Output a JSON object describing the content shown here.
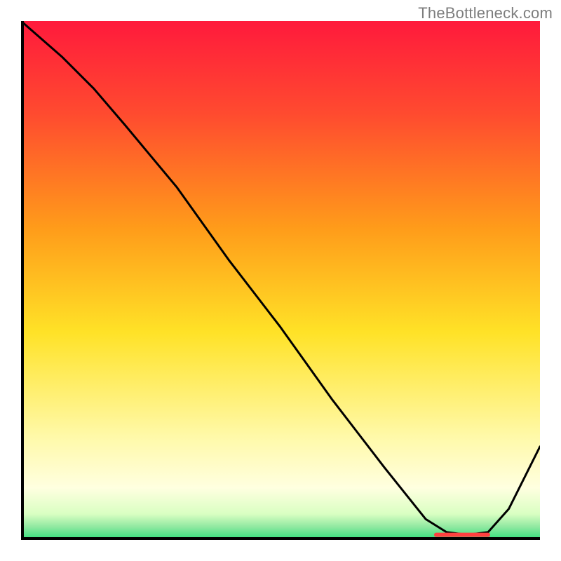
{
  "watermark": "TheBottleneck.com",
  "marker": {
    "label": ""
  },
  "colors": {
    "top": "#ff1a3c",
    "upper_orange": "#ff7a1f",
    "mid_yellow": "#ffe227",
    "pale_yellow": "#ffffc2",
    "green": "#2fe07a",
    "line": "#000000",
    "marker": "#ff4040"
  },
  "chart_data": {
    "type": "line",
    "title": "",
    "xlabel": "",
    "ylabel": "",
    "xlim": [
      0,
      100
    ],
    "ylim": [
      0,
      100
    ],
    "x": [
      0,
      8,
      14,
      20,
      25,
      30,
      40,
      50,
      60,
      70,
      78,
      82,
      86,
      90,
      94,
      100
    ],
    "y": [
      100,
      93,
      87,
      80,
      74,
      68,
      54,
      41,
      27,
      14,
      4,
      1.5,
      1,
      1.5,
      6,
      18
    ],
    "background_gradient_stops": [
      {
        "pos": 0.0,
        "hex": "#ff1a3c"
      },
      {
        "pos": 0.18,
        "hex": "#ff4b2f"
      },
      {
        "pos": 0.4,
        "hex": "#ff9c1a"
      },
      {
        "pos": 0.6,
        "hex": "#ffe227"
      },
      {
        "pos": 0.8,
        "hex": "#fff9a8"
      },
      {
        "pos": 0.9,
        "hex": "#ffffe0"
      },
      {
        "pos": 0.95,
        "hex": "#d9ffc2"
      },
      {
        "pos": 0.975,
        "hex": "#8fe8a0"
      },
      {
        "pos": 1.0,
        "hex": "#2fe07a"
      }
    ],
    "marker_segment": {
      "x0": 80,
      "x1": 90,
      "y": 1
    }
  }
}
